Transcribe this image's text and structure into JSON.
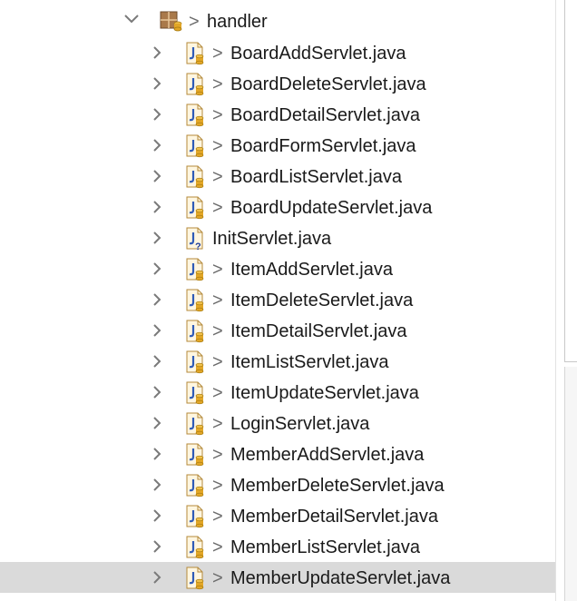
{
  "package": {
    "name": "handler",
    "dirty_marker": ">"
  },
  "files": [
    {
      "name": "BoardAddServlet.java",
      "dirty": true
    },
    {
      "name": "BoardDeleteServlet.java",
      "dirty": true
    },
    {
      "name": "BoardDetailServlet.java",
      "dirty": true
    },
    {
      "name": "BoardFormServlet.java",
      "dirty": true
    },
    {
      "name": "BoardListServlet.java",
      "dirty": true
    },
    {
      "name": "BoardUpdateServlet.java",
      "dirty": true
    },
    {
      "name": "InitServlet.java",
      "dirty": false,
      "unversioned": true
    },
    {
      "name": "ItemAddServlet.java",
      "dirty": true
    },
    {
      "name": "ItemDeleteServlet.java",
      "dirty": true
    },
    {
      "name": "ItemDetailServlet.java",
      "dirty": true
    },
    {
      "name": "ItemListServlet.java",
      "dirty": true
    },
    {
      "name": "ItemUpdateServlet.java",
      "dirty": true
    },
    {
      "name": "LoginServlet.java",
      "dirty": true
    },
    {
      "name": "MemberAddServlet.java",
      "dirty": true
    },
    {
      "name": "MemberDeleteServlet.java",
      "dirty": true
    },
    {
      "name": "MemberDetailServlet.java",
      "dirty": true
    },
    {
      "name": "MemberListServlet.java",
      "dirty": true
    },
    {
      "name": "MemberUpdateServlet.java",
      "dirty": true,
      "selected": true
    }
  ],
  "colors": {
    "selection": "#dadada",
    "java_icon_blue": "#2f5bb7",
    "repo_cylinder": "#e2a626",
    "dirty_marker": "#6b6b6b"
  },
  "icons": {
    "package": "package-icon",
    "java_file": "java-file-icon",
    "expand": "chevron-right-icon",
    "collapse": "chevron-down-icon"
  }
}
